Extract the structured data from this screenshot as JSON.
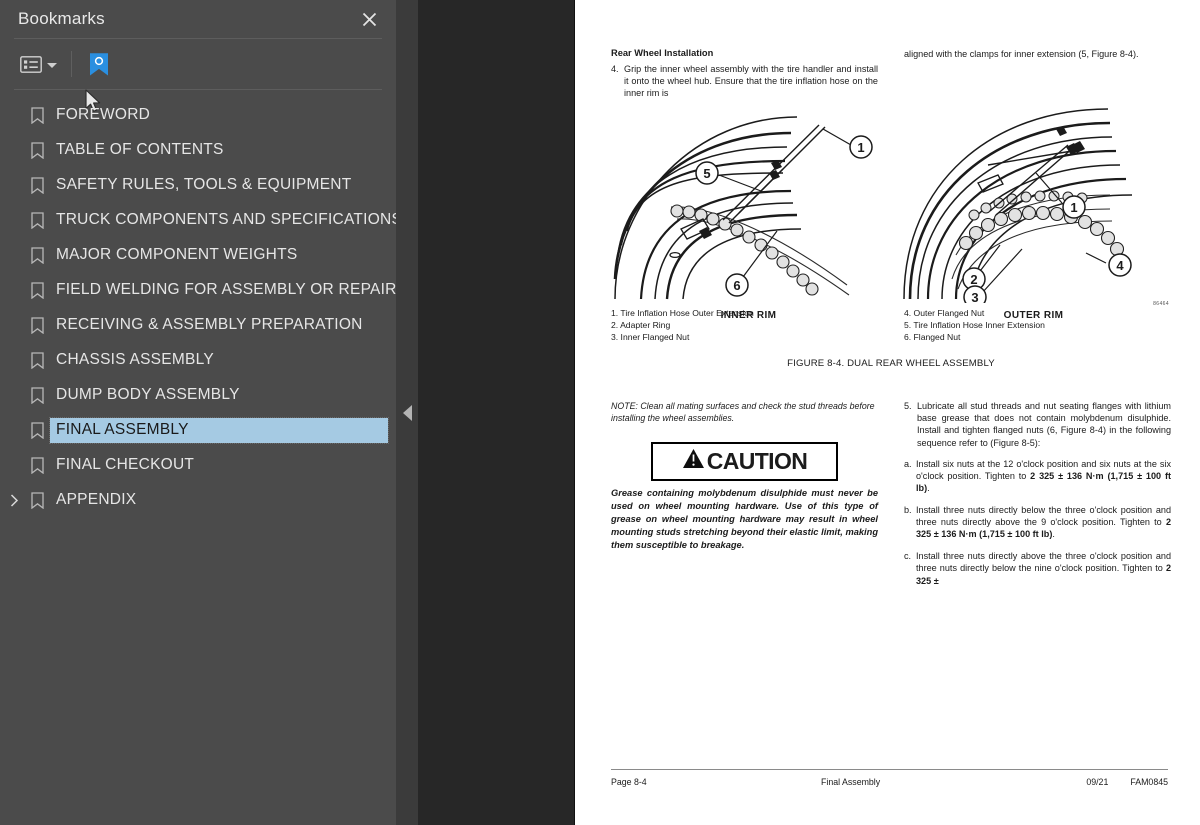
{
  "sidebar": {
    "title": "Bookmarks",
    "close_icon": "close-icon",
    "toolbar": {
      "options_icon": "list-options-icon",
      "dropdown_icon": "chevron-down-icon",
      "bookmark_tool_icon": "new-bookmark-icon",
      "accent_color": "#2a8fe0"
    },
    "selected_index": 10,
    "selection_color": "#a5cae3",
    "items": [
      {
        "label": "FOREWORD",
        "expandable": false
      },
      {
        "label": "TABLE OF CONTENTS",
        "expandable": false
      },
      {
        "label": "SAFETY RULES, TOOLS & EQUIPMENT",
        "expandable": false
      },
      {
        "label": "TRUCK COMPONENTS AND SPECIFICATIONS",
        "expandable": false
      },
      {
        "label": "MAJOR COMPONENT WEIGHTS",
        "expandable": false
      },
      {
        "label": "FIELD WELDING FOR ASSEMBLY OR REPAIR",
        "expandable": false
      },
      {
        "label": "RECEIVING & ASSEMBLY PREPARATION",
        "expandable": false
      },
      {
        "label": "CHASSIS ASSEMBLY",
        "expandable": false
      },
      {
        "label": "DUMP BODY ASSEMBLY",
        "expandable": false
      },
      {
        "label": "FINAL ASSEMBLY",
        "expandable": false
      },
      {
        "label": "FINAL CHECKOUT",
        "expandable": false
      },
      {
        "label": "APPENDIX",
        "expandable": true
      }
    ]
  },
  "splitter": {
    "collapse_icon": "collapse-left-icon"
  },
  "document": {
    "left_column": {
      "heading": "Rear Wheel Installation",
      "step_number": "4.",
      "step_text": "Grip the inner wheel assembly with the tire handler and install it onto the wheel hub. Ensure that the tire inflation hose on the inner rim is"
    },
    "right_column": {
      "continuation": "aligned with the clamps for inner extension (5, Figure 8-4)."
    },
    "figure": {
      "left_image_label": "INNER RIM",
      "right_image_label": "OUTER RIM",
      "drawing_number": "86464",
      "left_callouts": [
        "1",
        "5",
        "6"
      ],
      "right_callouts": [
        "1",
        "2",
        "3",
        "4"
      ],
      "parts_left": [
        "1. Tire Inflation Hose Outer Extension",
        "2. Adapter Ring",
        "3. Inner Flanged Nut"
      ],
      "parts_right": [
        "4. Outer Flanged Nut",
        "5. Tire Inflation Hose Inner Extension",
        "6. Flanged Nut"
      ],
      "caption": "FIGURE 8-4. DUAL REAR WHEEL ASSEMBLY"
    },
    "note": "NOTE: Clean all mating surfaces and check the stud threads before installing the wheel assemblies.",
    "caution": {
      "label": "CAUTION",
      "icon": "warning-triangle-icon",
      "body": "Grease containing molybdenum disulphide must never be used on wheel mounting hardware. Use of this type of grease on wheel mounting hardware may result in wheel mounting studs stretching beyond their elastic limit, making them susceptible to breakage."
    },
    "step5": {
      "number": "5.",
      "text": "Lubricate all stud threads and nut seating flanges with lithium base grease that does not contain molybdenum disulphide. Install and tighten flanged nuts (6, Figure 8-4) in the following sequence refer to (Figure 8-5):",
      "subitems": [
        {
          "marker": "a.",
          "text": "Install six nuts at the 12 o'clock position and six nuts at the six o'clock position. Tighten to ",
          "torque": "2 325 ± 136 N·m (1,715 ± 100 ft lb)",
          "tail": "."
        },
        {
          "marker": "b.",
          "text": "Install three nuts directly below the three o'clock position and three nuts directly above the 9 o'clock position. Tighten to ",
          "torque": "2 325 ± 136 N·m (1,715 ± 100 ft lb)",
          "tail": "."
        },
        {
          "marker": "c.",
          "text": "Install three nuts directly above the three o'clock position and three nuts directly below the nine o'clock position. Tighten to ",
          "torque": "2 325 ±",
          "tail": ""
        }
      ]
    },
    "footer": {
      "page": "Page 8-4",
      "section": "Final Assembly",
      "date": "09/21",
      "doc_code": "FAM0845"
    }
  }
}
